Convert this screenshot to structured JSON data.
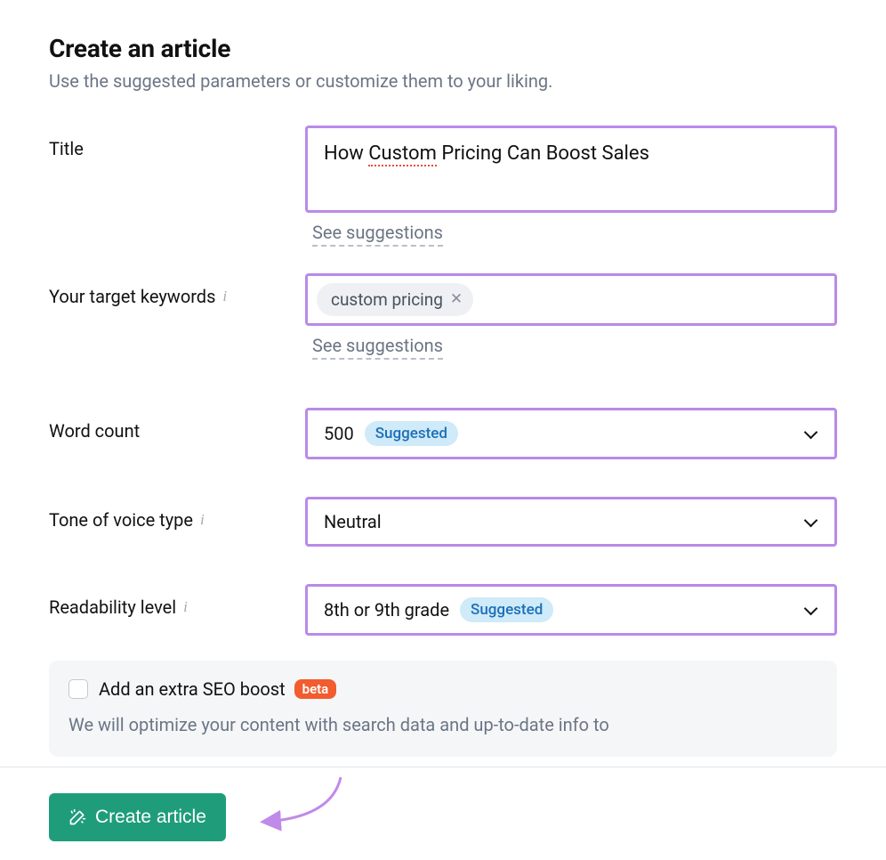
{
  "header": {
    "title": "Create an article",
    "subtitle": "Use the suggested parameters or customize them to your liking."
  },
  "fields": {
    "title": {
      "label": "Title",
      "value_pre": "How ",
      "value_mid": "Custom",
      "value_post": " Pricing Can Boost Sales",
      "suggestions_link": "See suggestions"
    },
    "keywords": {
      "label": "Your target keywords",
      "chips": [
        {
          "text": "custom pricing"
        }
      ],
      "suggestions_link": "See suggestions"
    },
    "word_count": {
      "label": "Word count",
      "value": "500",
      "badge": "Suggested"
    },
    "tone": {
      "label": "Tone of voice type",
      "value": "Neutral"
    },
    "readability": {
      "label": "Readability level",
      "value": "8th or 9th grade",
      "badge": "Suggested"
    }
  },
  "seo_boost": {
    "checkbox_label": "Add an extra SEO boost",
    "badge": "beta",
    "description": "We will optimize your content with search data and up-to-date info to"
  },
  "actions": {
    "create": "Create article"
  }
}
